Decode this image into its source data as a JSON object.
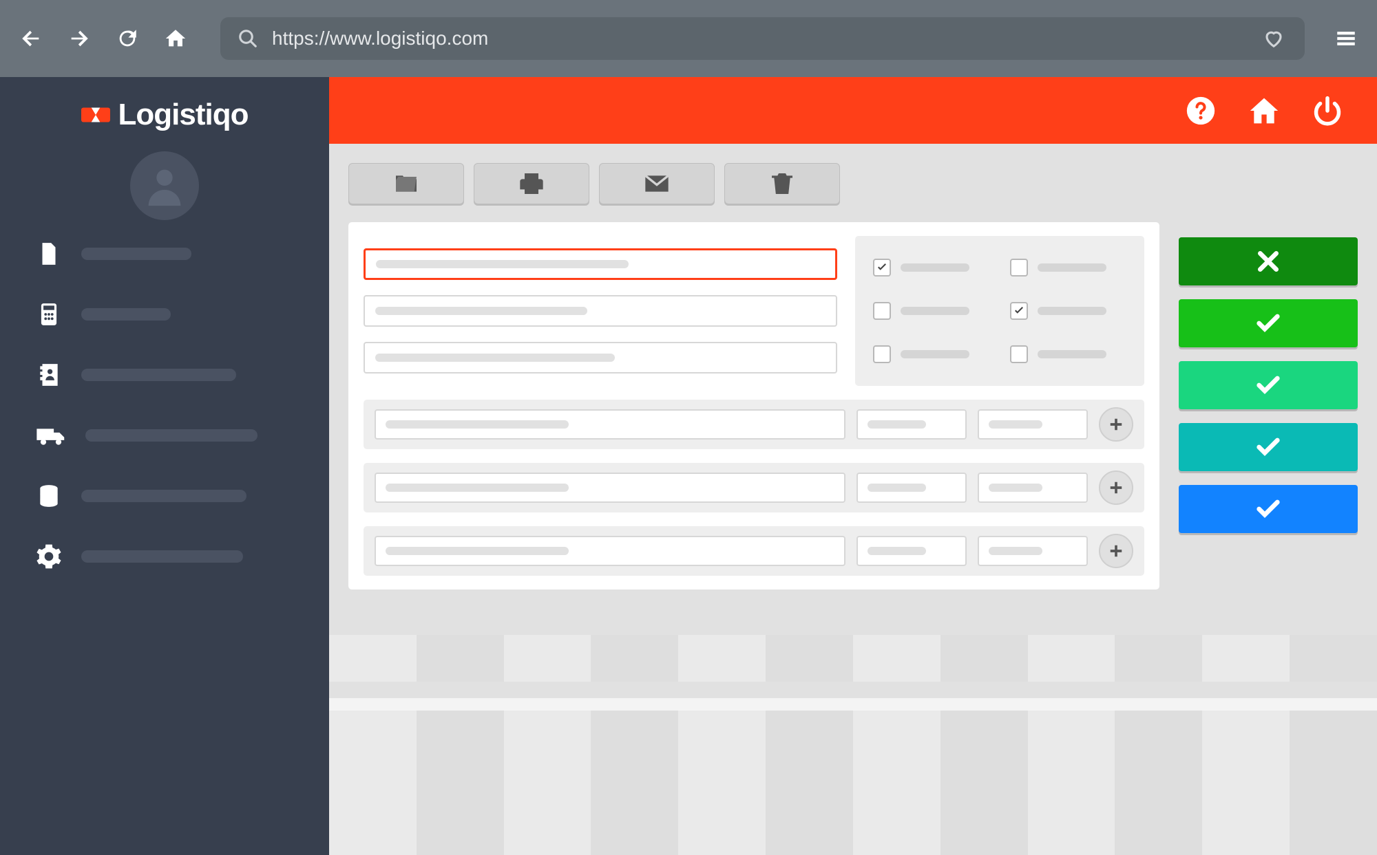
{
  "browser": {
    "url": "https://www.logistiqo.com"
  },
  "brand": {
    "name": "Logistiqo"
  },
  "sidebar": {
    "items": [
      {
        "icon": "document-icon"
      },
      {
        "icon": "calculator-icon"
      },
      {
        "icon": "contacts-icon"
      },
      {
        "icon": "truck-icon"
      },
      {
        "icon": "database-icon"
      },
      {
        "icon": "gear-icon"
      }
    ]
  },
  "header": {
    "buttons": [
      "help",
      "home",
      "power"
    ]
  },
  "toolbar": {
    "buttons": [
      "folder",
      "print",
      "mail",
      "trash"
    ]
  },
  "form": {
    "text_fields": [
      {
        "active": true
      },
      {
        "active": false
      },
      {
        "active": false
      }
    ],
    "checkboxes": [
      {
        "checked": true
      },
      {
        "checked": false
      },
      {
        "checked": false
      },
      {
        "checked": true
      },
      {
        "checked": false
      },
      {
        "checked": false
      }
    ],
    "rows": [
      {},
      {},
      {}
    ]
  },
  "status_buttons": [
    {
      "color": "#0f8a0f",
      "type": "close"
    },
    {
      "color": "#17c018",
      "type": "check"
    },
    {
      "color": "#1ad67f",
      "type": "check"
    },
    {
      "color": "#0abab5",
      "type": "check"
    },
    {
      "color": "#1283ff",
      "type": "check"
    }
  ]
}
